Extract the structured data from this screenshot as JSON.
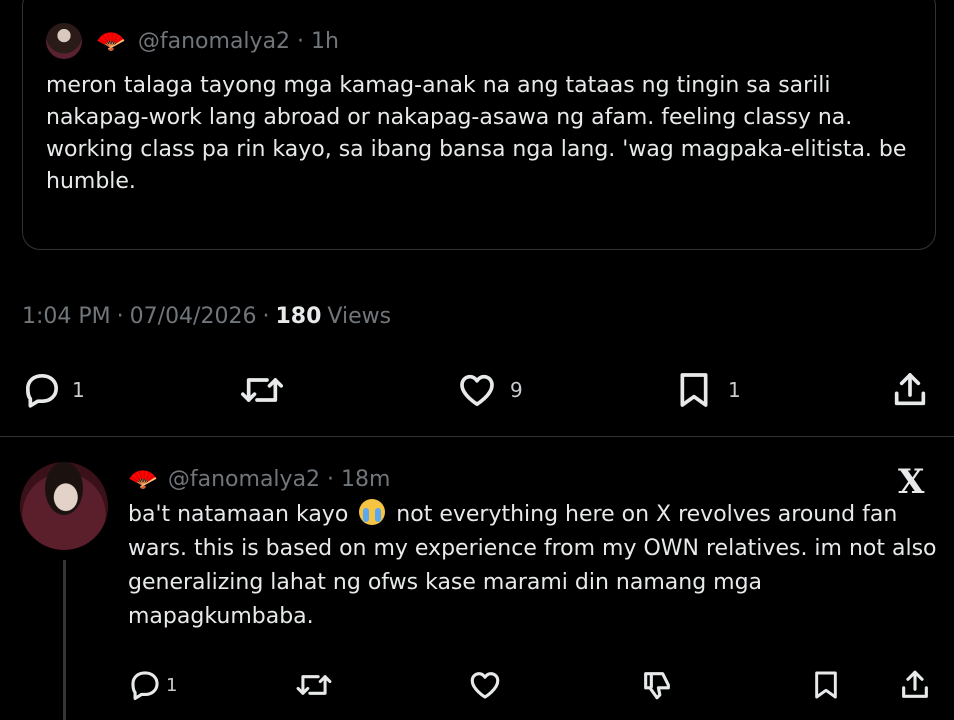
{
  "quoted_tweet": {
    "handle": "@fanomalya2",
    "time": "1h",
    "text": "meron talaga tayong mga kamag-anak na ang tataas ng tingin sa sarili nakapag-work lang abroad or nakapag-asawa ng afam. feeling classy na. working class pa rin kayo, sa ibang bansa nga lang. 'wag magpaka-elitista. be humble."
  },
  "meta": {
    "time": "1:04 PM",
    "date": "07/04/2026",
    "views_count": "180",
    "views_label": "Views",
    "separator": "·"
  },
  "main_actions": {
    "reply_count": "1",
    "retweet_count": "",
    "like_count": "9",
    "bookmark_count": "1"
  },
  "reply_tweet": {
    "handle": "@fanomalya2",
    "time": "18m",
    "text_before_emoji": "ba't natamaan kayo",
    "text_after_emoji": " not everything here on X revolves around fan wars. this is based on my experience from my OWN relatives. im not also generalizing lahat ng ofws kase marami din namang mga mapagkumbaba.",
    "x_logo": "X",
    "reply_count": "1"
  },
  "colors": {
    "background": "#000000",
    "text": "#e7e9ea",
    "muted": "#71767b",
    "border": "#2f3336"
  },
  "icons": [
    "reply-icon",
    "retweet-icon",
    "like-icon",
    "bookmark-icon",
    "share-icon",
    "dislike-icon",
    "fan-emoji-icon",
    "crying-emoji-icon",
    "x-logo-icon"
  ]
}
